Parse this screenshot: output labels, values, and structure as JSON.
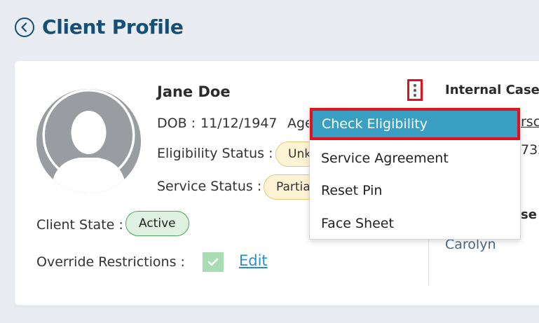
{
  "page": {
    "title": "Client Profile"
  },
  "client": {
    "name": "Jane Doe",
    "dob_label": "DOB :",
    "dob_value": "11/12/1947",
    "age_fragment": "Age",
    "eligibility_label": "Eligibility Status :",
    "eligibility_value": "Unk",
    "service_label": "Service Status :",
    "service_value": "Partia",
    "state_label": "Client State :",
    "state_value": "Active",
    "override_label": "Override Restrictions :",
    "override_checked": true,
    "edit_label": "Edit"
  },
  "right_panel": {
    "heading": "Internal Case",
    "fragment_link": "rsc",
    "fragment_number": "732",
    "fragment_heading": "se",
    "fragment_name": "Carolyn"
  },
  "actions_menu": {
    "items": [
      {
        "label": "Check Eligibility",
        "active": true
      },
      {
        "label": "Service Agreement",
        "active": false
      },
      {
        "label": "Reset Pin",
        "active": false
      },
      {
        "label": "Face Sheet",
        "active": false
      }
    ]
  },
  "colors": {
    "primary": "#134f78",
    "link": "#2a8fc0",
    "menu_active": "#39a0c3",
    "highlight_outline": "#e0121d",
    "badge_warning_bg": "#fff3d6",
    "badge_success_bg": "#dff2e2"
  },
  "icons": {
    "back": "chevron-left-circle-icon",
    "avatar": "user-silhouette-icon",
    "more": "kebab-vertical-icon",
    "check": "check-icon"
  }
}
